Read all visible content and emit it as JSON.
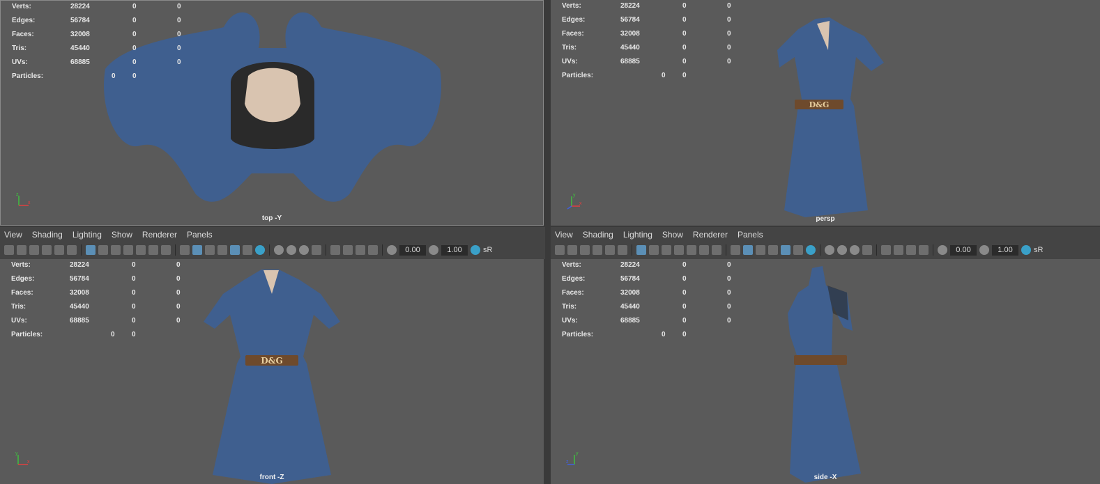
{
  "stats": {
    "labels": [
      "Verts:",
      "Edges:",
      "Faces:",
      "Tris:",
      "UVs:",
      "Particles:"
    ],
    "rows": [
      [
        "28224",
        "0",
        "0"
      ],
      [
        "56784",
        "0",
        "0"
      ],
      [
        "32008",
        "0",
        "0"
      ],
      [
        "45440",
        "0",
        "0"
      ],
      [
        "68885",
        "0",
        "0"
      ],
      [
        "0",
        "0"
      ]
    ]
  },
  "viewports": {
    "top": {
      "camera": "top -Y"
    },
    "persp": {
      "camera": "persp"
    },
    "front": {
      "camera": "front -Z"
    },
    "side": {
      "camera": "side -X"
    }
  },
  "panel_menu": [
    "View",
    "Shading",
    "Lighting",
    "Show",
    "Renderer",
    "Panels"
  ],
  "toolbar": {
    "exposure": "0.00",
    "gamma": "1.00",
    "color_space": "sR"
  },
  "belt_text": "D&G",
  "axis_labels": {
    "y": "y",
    "x": "x",
    "z": "z"
  },
  "colors": {
    "viewport_bg": "#5a5a5a",
    "denim": "#3f5f8f",
    "belt": "#6e4a2c"
  }
}
